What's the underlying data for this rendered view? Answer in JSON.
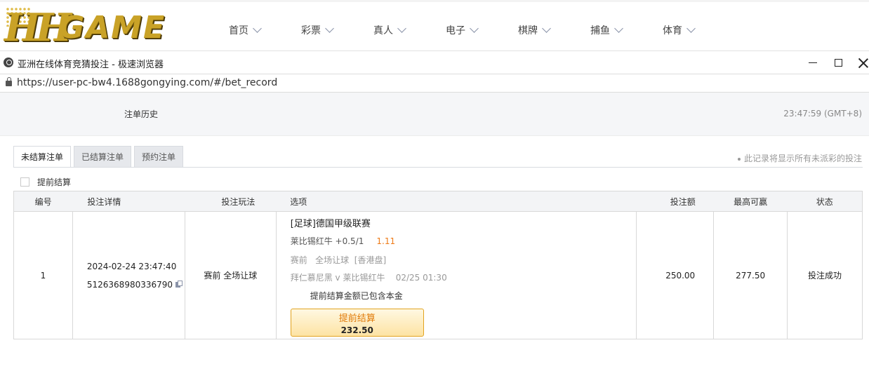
{
  "logo": {
    "hh": "HH",
    "game": "GAME"
  },
  "nav": [
    {
      "label": "首页"
    },
    {
      "label": "彩票"
    },
    {
      "label": "真人"
    },
    {
      "label": "电子"
    },
    {
      "label": "棋牌"
    },
    {
      "label": "捕鱼"
    },
    {
      "label": "体育"
    }
  ],
  "window": {
    "title": "亚洲在线体育竞猜投注 - 极速浏览器",
    "url": "https://user-pc-bw4.1688gongying.com/#/bet_record"
  },
  "page": {
    "title": "注单历史",
    "clock": "23:47:59 (GMT+8)"
  },
  "tabs": [
    {
      "label": "未结算注单",
      "active": true
    },
    {
      "label": "已结算注单",
      "active": false
    },
    {
      "label": "预约注单",
      "active": false
    }
  ],
  "note": "此记录将显示所有未派彩的投注",
  "early_settle_label": "提前结算",
  "table": {
    "headers": [
      "编号",
      "投注详情",
      "投注玩法",
      "选项",
      "投注额",
      "最高可赢",
      "状态"
    ],
    "rows": [
      {
        "no": "1",
        "time": "2024-02-24 23:47:40",
        "order_id": "5126368980336790",
        "play": "赛前 全场让球",
        "league": "[足球]德国甲级联赛",
        "pick": "莱比锡红牛 +0.5/1",
        "odds": "1.11",
        "meta": "赛前   全场让球  [香港盘]",
        "match": "拜仁慕尼黑 v 莱比锡红牛    02/25 01:30",
        "included_note": "提前结算金额已包含本金",
        "cashout_label": "提前结算",
        "cashout_amount": "232.50",
        "stake": "250.00",
        "max_win": "277.50",
        "status": "投注成功"
      }
    ]
  }
}
